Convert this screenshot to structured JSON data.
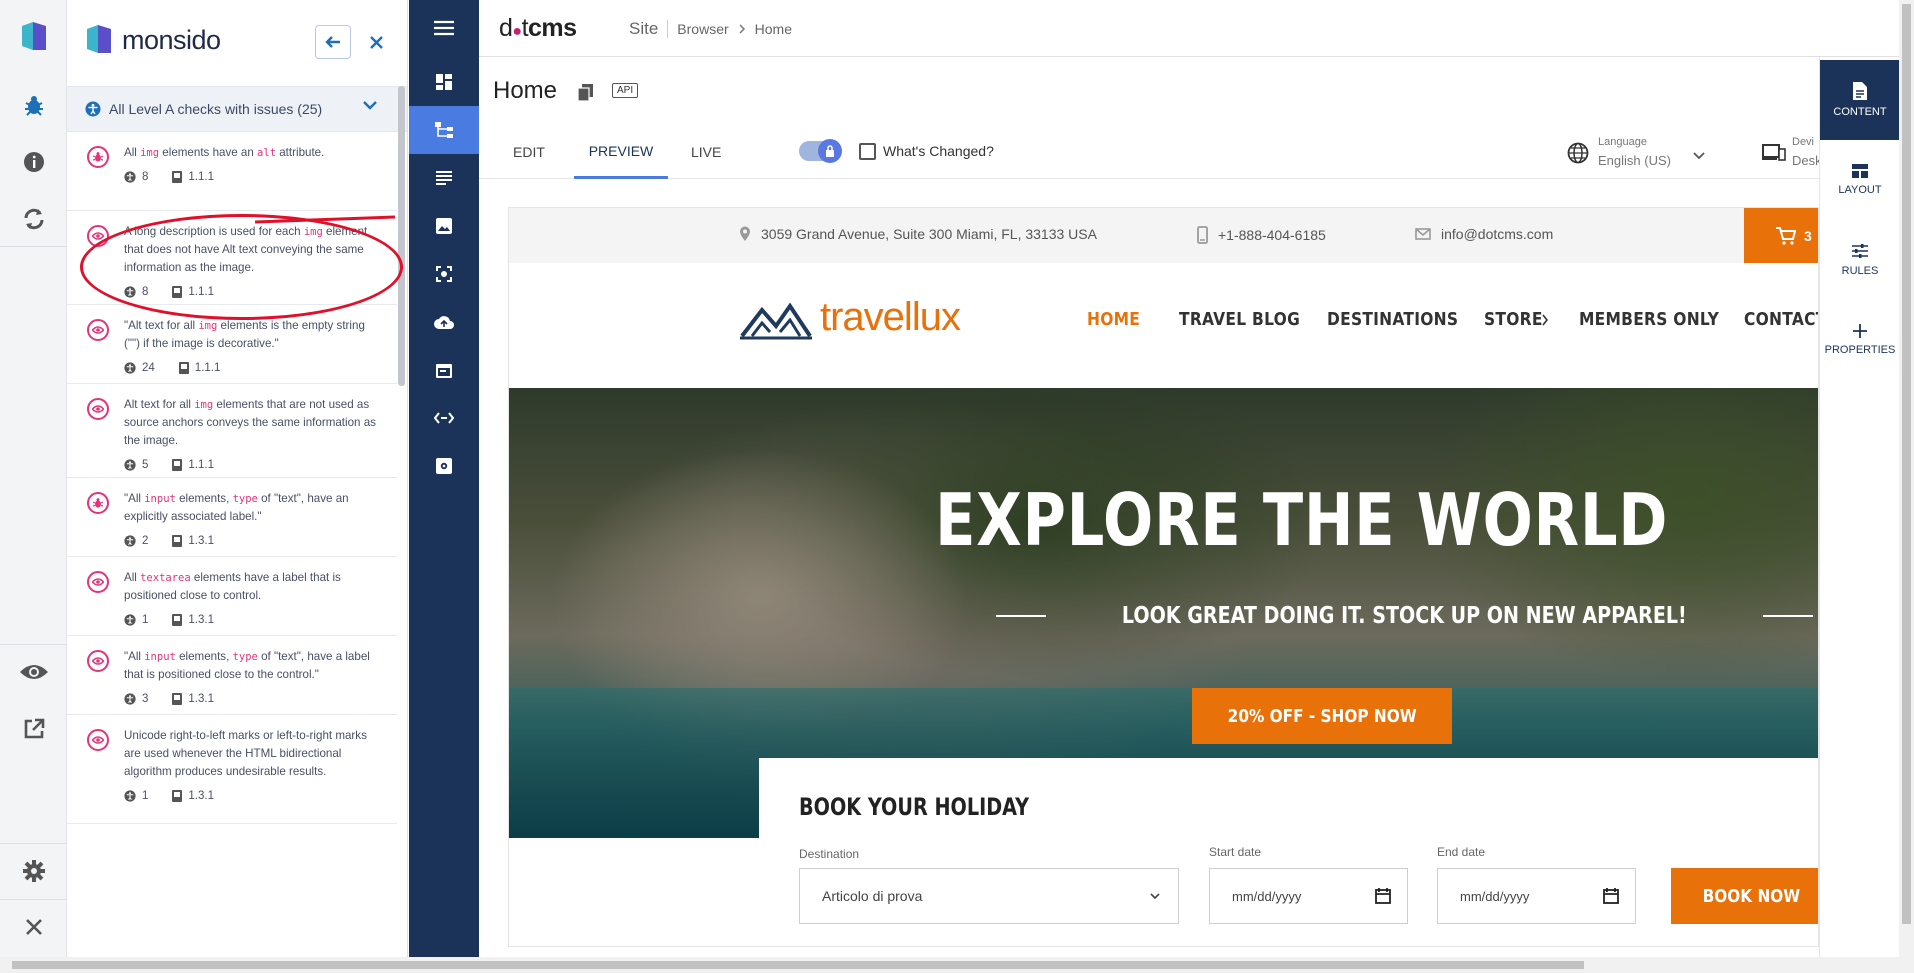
{
  "monsido": {
    "logo_text": "monsido",
    "filter_label": "All Level A checks with issues (25)",
    "issues": [
      {
        "segments": [
          [
            "t",
            "All "
          ],
          [
            "c",
            "img"
          ],
          [
            "t",
            " elements have an "
          ],
          [
            "c",
            "alt"
          ],
          [
            "t",
            " attribute."
          ]
        ],
        "count": "8",
        "criterion": "1.1.1",
        "icon": "bug-icon"
      },
      {
        "segments": [
          [
            "t",
            "A long description is used for each "
          ],
          [
            "c",
            "img"
          ],
          [
            "t",
            " element that does not have Alt text conveying the same information as the image."
          ]
        ],
        "count": "8",
        "criterion": "1.1.1",
        "icon": "eye-icon"
      },
      {
        "segments": [
          [
            "t",
            "\"Alt text for all "
          ],
          [
            "c",
            "img"
          ],
          [
            "t",
            " elements is the empty string (\"\") if the image is decorative.\""
          ]
        ],
        "count": "24",
        "criterion": "1.1.1",
        "icon": "eye-icon"
      },
      {
        "segments": [
          [
            "t",
            "Alt text for all "
          ],
          [
            "c",
            "img"
          ],
          [
            "t",
            " elements that are not used as source anchors conveys the same information as the image."
          ]
        ],
        "count": "5",
        "criterion": "1.1.1",
        "icon": "eye-icon"
      },
      {
        "segments": [
          [
            "t",
            "\"All "
          ],
          [
            "c",
            "input"
          ],
          [
            "t",
            " elements, "
          ],
          [
            "c",
            "type"
          ],
          [
            "t",
            " of \"text\", have an explicitly associated label.\""
          ]
        ],
        "count": "2",
        "criterion": "1.3.1",
        "icon": "bug-icon"
      },
      {
        "segments": [
          [
            "t",
            "All "
          ],
          [
            "c",
            "textarea"
          ],
          [
            "t",
            " elements have a label that is positioned close to control."
          ]
        ],
        "count": "1",
        "criterion": "1.3.1",
        "icon": "eye-icon"
      },
      {
        "segments": [
          [
            "t",
            "\"All "
          ],
          [
            "c",
            "input"
          ],
          [
            "t",
            " elements, "
          ],
          [
            "c",
            "type"
          ],
          [
            "t",
            " of \"text\", have a label that is positioned close to the control.\""
          ]
        ],
        "count": "3",
        "criterion": "1.3.1",
        "icon": "eye-icon"
      },
      {
        "segments": [
          [
            "t",
            "Unicode right-to-left marks or left-to-right marks are used whenever the HTML bidirectional algorithm produces undesirable results."
          ]
        ],
        "count": "1",
        "criterion": "1.3.1",
        "icon": "eye-icon"
      }
    ]
  },
  "dotcms": {
    "brand_prefix": "d",
    "brand_mid": "t",
    "brand_suffix": "cms",
    "crumbs": {
      "site": "Site",
      "browser": "Browser",
      "home": "Home"
    },
    "page_title": "Home",
    "api_badge": "API",
    "modes": [
      "EDIT",
      "PREVIEW",
      "LIVE"
    ],
    "whats_changed": "What's Changed?",
    "language_caption": "Language",
    "language_value": "English (US)",
    "device_caption": "Devi",
    "device_value": "Desk",
    "right_panel": [
      "CONTENT",
      "LAYOUT",
      "RULES",
      "PROPERTIES"
    ]
  },
  "site": {
    "address": "3059 Grand Avenue, Suite 300 Miami, FL, 33133 USA",
    "phone": "+1-888-404-6185",
    "email": "info@dotcms.com",
    "cart_count": "3",
    "logo_text": "travellux",
    "nav": [
      "HOME",
      "TRAVEL BLOG",
      "DESTINATIONS",
      "STORE",
      "MEMBERS ONLY",
      "CONTACT U"
    ],
    "hero_title": "EXPLORE THE WORLD",
    "hero_subtitle": "LOOK GREAT DOING IT. STOCK UP ON NEW APPAREL!",
    "hero_cta": "20% OFF - SHOP NOW",
    "book_title": "BOOK YOUR HOLIDAY",
    "destination_label": "Destination",
    "destination_value": "Articolo di prova",
    "start_label": "Start date",
    "end_label": "End date",
    "date_placeholder": "mm/dd/yyyy",
    "book_button": "BOOK NOW"
  },
  "colors": {
    "accent_orange": "#e8710a",
    "nav_navy": "#1b3359",
    "issue_pink": "#e3347a",
    "annotation_red": "#e0102a"
  }
}
